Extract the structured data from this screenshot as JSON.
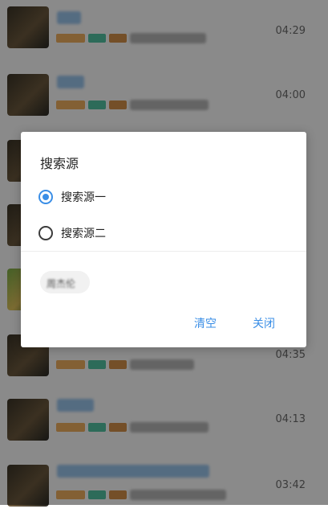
{
  "list": {
    "rows": [
      {
        "duration": "04:29"
      },
      {
        "duration": "04:00"
      },
      {
        "duration": ""
      },
      {
        "duration": ""
      },
      {
        "duration": ""
      },
      {
        "duration": "04:35"
      },
      {
        "duration": "04:13"
      },
      {
        "duration": "03:42"
      }
    ]
  },
  "dialog": {
    "title": "搜索源",
    "options": [
      {
        "label": "搜索源一",
        "checked": true
      },
      {
        "label": "搜索源二",
        "checked": false
      }
    ],
    "history": [
      "周杰伦"
    ],
    "buttons": {
      "clear": "清空",
      "close": "关闭"
    }
  },
  "colors": {
    "accent": "#3a8ee6"
  }
}
